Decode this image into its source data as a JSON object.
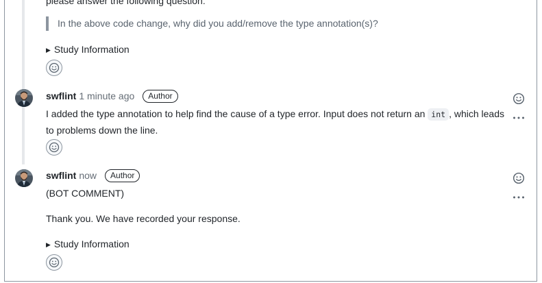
{
  "header": {
    "question_prompt": "please answer the following question:",
    "question": "In the above code change, why did you add/remove the type annotation(s)?",
    "study_info_label": "Study Information"
  },
  "comments": [
    {
      "author": "swflint",
      "time": "1 minute ago",
      "badge": "Author",
      "text_before": "I added the type annotation to help find the cause of a type error. Input does not return an ",
      "code": "int",
      "text_after": ", which leads to problems down the line."
    },
    {
      "author": "swflint",
      "time": "now",
      "badge": "Author",
      "line1": "(BOT COMMENT)",
      "line2": "Thank you. We have recorded your response.",
      "study_info_label": "Study Information"
    }
  ],
  "icons": {
    "reaction": "smiley-icon",
    "more": "kebab-horizontal-icon"
  },
  "colors": {
    "border": "#8c959f",
    "muted": "#656d76",
    "code_bg": "#eef0f3"
  }
}
